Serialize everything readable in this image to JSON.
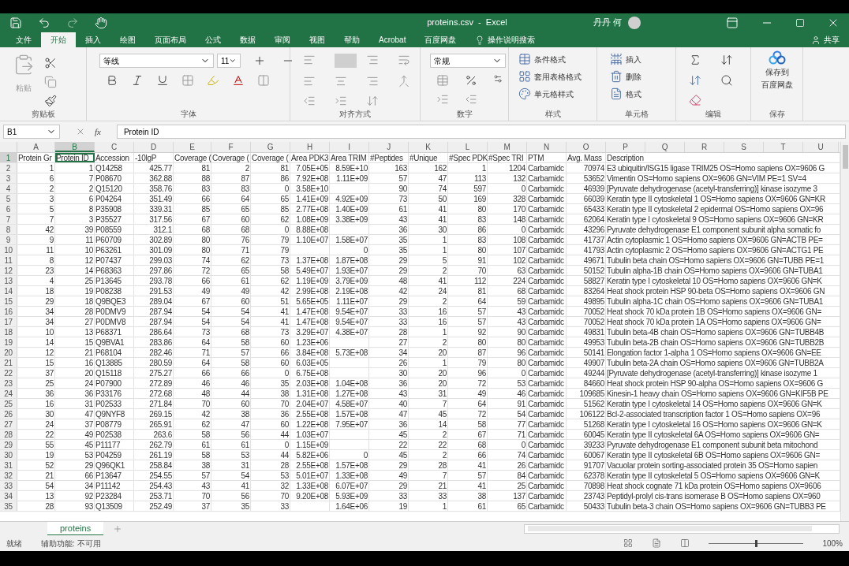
{
  "title_bar": {
    "title": "proteins.csv  -  Excel",
    "user": "丹丹 何"
  },
  "ribbon_tabs": [
    {
      "label": "文件",
      "selected": false
    },
    {
      "label": "开始",
      "selected": true
    },
    {
      "label": "插入",
      "selected": false
    },
    {
      "label": "绘图",
      "selected": false
    },
    {
      "label": "页面布局",
      "selected": false
    },
    {
      "label": "公式",
      "selected": false
    },
    {
      "label": "数据",
      "selected": false
    },
    {
      "label": "审阅",
      "selected": false
    },
    {
      "label": "视图",
      "selected": false
    },
    {
      "label": "帮助",
      "selected": false
    },
    {
      "label": "Acrobat",
      "selected": false
    },
    {
      "label": "百度网盘",
      "selected": false
    }
  ],
  "tell_me": "操作说明搜索",
  "share": "共享",
  "ribbon": {
    "clipboard": {
      "paste": "粘贴",
      "label": "剪贴板"
    },
    "font": {
      "font_name": "等线",
      "font_size": "11",
      "label": "字体"
    },
    "alignment": {
      "label": "对齐方式"
    },
    "number": {
      "format": "常规",
      "label": "数字"
    },
    "styles": {
      "items": [
        "条件格式",
        "套用表格格式",
        "单元格样式"
      ],
      "label": "样式"
    },
    "cells": {
      "items": [
        "插入",
        "删除",
        "格式"
      ],
      "label": "单元格"
    },
    "editing": {
      "label": "编辑"
    },
    "save": {
      "button": [
        "保存到",
        "百度网盘"
      ],
      "label": "保存"
    }
  },
  "formula_bar": {
    "name_box": "B1",
    "fx": "fx",
    "formula": "Protein ID"
  },
  "columns": [
    {
      "letter": "A",
      "selected": false
    },
    {
      "letter": "B",
      "selected": true
    },
    {
      "letter": "C",
      "selected": false
    },
    {
      "letter": "D",
      "selected": false
    },
    {
      "letter": "E",
      "selected": false
    },
    {
      "letter": "F",
      "selected": false
    },
    {
      "letter": "G",
      "selected": false
    },
    {
      "letter": "H",
      "selected": false
    },
    {
      "letter": "I",
      "selected": false
    },
    {
      "letter": "J",
      "selected": false
    },
    {
      "letter": "K",
      "selected": false
    },
    {
      "letter": "L",
      "selected": false
    },
    {
      "letter": "M",
      "selected": false
    },
    {
      "letter": "N",
      "selected": false
    },
    {
      "letter": "O",
      "selected": false
    },
    {
      "letter": "P",
      "selected": false
    },
    {
      "letter": "Q",
      "selected": false
    },
    {
      "letter": "R",
      "selected": false
    },
    {
      "letter": "S",
      "selected": false
    },
    {
      "letter": "T",
      "selected": false
    },
    {
      "letter": "U",
      "selected": false
    }
  ],
  "rows": [
    {
      "number": "1",
      "selected": true,
      "cells": [
        "Protein Gr",
        "Protein ID",
        "Accession",
        "-10lgP",
        "Coverage (",
        "Coverage (",
        "Coverage (",
        "Area PDK3",
        "Area TRIM",
        "#Peptides",
        "#Unique",
        "#Spec PDK",
        "#Spec TRI",
        "PTM",
        "Avg. Mass",
        "Description"
      ]
    },
    {
      "number": "2",
      "selected": false,
      "cells": [
        "1",
        "1",
        "Q14258",
        "425.77",
        "81",
        "2",
        "81",
        "7.05E+05",
        "8.59E+10",
        "163",
        "162",
        "1",
        "1204",
        "Carbamidc",
        "70974",
        "E3 ubiquitin/ISG15 ligase TRIM25 OS=Homo sapiens OX=9606 G"
      ]
    },
    {
      "number": "3",
      "selected": false,
      "cells": [
        "6",
        "7",
        "P08670",
        "362.88",
        "88",
        "87",
        "86",
        "7.92E+08",
        "1.11E+09",
        "57",
        "47",
        "113",
        "132",
        "Carbamidc",
        "53652",
        "Vimentin OS=Homo sapiens OX=9606 GN=VIM PE=1 SV=4"
      ]
    },
    {
      "number": "4",
      "selected": false,
      "cells": [
        "2",
        "2",
        "Q15120",
        "358.76",
        "83",
        "83",
        "0",
        "3.58E+10",
        "",
        "90",
        "74",
        "597",
        "0",
        "Carbamidc",
        "46939",
        "[Pyruvate dehydrogenase (acetyl-transferring)] kinase isozyme 3"
      ]
    },
    {
      "number": "5",
      "selected": false,
      "cells": [
        "3",
        "6",
        "P04264",
        "351.49",
        "66",
        "64",
        "65",
        "1.41E+09",
        "4.92E+09",
        "73",
        "50",
        "169",
        "328",
        "Carbamidc",
        "66039",
        "Keratin  type II cytoskeletal 1 OS=Homo sapiens OX=9606 GN=KR"
      ]
    },
    {
      "number": "6",
      "selected": false,
      "cells": [
        "5",
        "8",
        "P35908",
        "339.31",
        "85",
        "65",
        "85",
        "2.77E+08",
        "1.40E+09",
        "61",
        "41",
        "80",
        "170",
        "Carbamidc",
        "65433",
        "Keratin  type II cytoskeletal 2 epidermal OS=Homo sapiens OX=96"
      ]
    },
    {
      "number": "7",
      "selected": false,
      "cells": [
        "7",
        "3",
        "P35527",
        "317.56",
        "67",
        "60",
        "62",
        "1.08E+09",
        "3.38E+09",
        "43",
        "41",
        "83",
        "148",
        "Carbamidc",
        "62064",
        "Keratin  type I cytoskeletal 9 OS=Homo sapiens OX=9606 GN=KR"
      ]
    },
    {
      "number": "8",
      "selected": false,
      "cells": [
        "42",
        "39",
        "P08559",
        "312.1",
        "68",
        "68",
        "0",
        "8.88E+08",
        "",
        "36",
        "30",
        "86",
        "0",
        "Carbamidc",
        "43296",
        "Pyruvate dehydrogenase E1 component subunit alpha  somatic fo"
      ]
    },
    {
      "number": "9",
      "selected": false,
      "cells": [
        "9",
        "11",
        "P60709",
        "302.89",
        "80",
        "76",
        "79",
        "1.10E+07",
        "1.58E+07",
        "35",
        "1",
        "83",
        "108",
        "Carbamidc",
        "41737",
        "Actin  cytoplasmic 1 OS=Homo sapiens OX=9606 GN=ACTB PE="
      ]
    },
    {
      "number": "10",
      "selected": false,
      "cells": [
        "11",
        "10",
        "P63261",
        "301.09",
        "80",
        "71",
        "79",
        "",
        "0",
        "35",
        "1",
        "80",
        "107",
        "Carbamidc",
        "41793",
        "Actin  cytoplasmic 2 OS=Homo sapiens OX=9606 GN=ACTG1 PE"
      ]
    },
    {
      "number": "11",
      "selected": false,
      "cells": [
        "8",
        "12",
        "P07437",
        "299.03",
        "74",
        "62",
        "73",
        "1.37E+08",
        "1.87E+08",
        "29",
        "5",
        "91",
        "102",
        "Carbamidc",
        "49671",
        "Tubulin beta chain OS=Homo sapiens OX=9606 GN=TUBB PE=1"
      ]
    },
    {
      "number": "12",
      "selected": false,
      "cells": [
        "23",
        "14",
        "P68363",
        "297.86",
        "72",
        "65",
        "58",
        "5.49E+07",
        "1.93E+07",
        "29",
        "2",
        "70",
        "63",
        "Carbamidc",
        "50152",
        "Tubulin alpha-1B chain OS=Homo sapiens OX=9606 GN=TUBA1"
      ]
    },
    {
      "number": "13",
      "selected": false,
      "cells": [
        "4",
        "25",
        "P13645",
        "293.78",
        "66",
        "61",
        "62",
        "1.19E+09",
        "3.79E+09",
        "48",
        "41",
        "112",
        "224",
        "Carbamidc",
        "58827",
        "Keratin  type I cytoskeletal 10 OS=Homo sapiens OX=9606 GN=K"
      ]
    },
    {
      "number": "14",
      "selected": false,
      "cells": [
        "18",
        "19",
        "P08238",
        "291.53",
        "49",
        "49",
        "42",
        "2.99E+08",
        "2.19E+08",
        "42",
        "24",
        "81",
        "68",
        "Carbamidc",
        "83264",
        "Heat shock protein HSP 90-beta OS=Homo sapiens OX=9606 GN"
      ]
    },
    {
      "number": "15",
      "selected": false,
      "cells": [
        "29",
        "18",
        "Q9BQE3",
        "289.04",
        "67",
        "60",
        "51",
        "5.65E+05",
        "1.11E+07",
        "29",
        "2",
        "64",
        "59",
        "Carbamidc",
        "49895",
        "Tubulin alpha-1C chain OS=Homo sapiens OX=9606 GN=TUBA1"
      ]
    },
    {
      "number": "16",
      "selected": false,
      "cells": [
        "34",
        "28",
        "P0DMV9",
        "287.94",
        "54",
        "54",
        "41",
        "1.47E+08",
        "9.54E+07",
        "33",
        "16",
        "57",
        "43",
        "Carbamidc",
        "70052",
        "Heat shock 70 kDa protein 1B OS=Homo sapiens OX=9606 GN="
      ]
    },
    {
      "number": "17",
      "selected": false,
      "cells": [
        "34",
        "27",
        "P0DMV8",
        "287.94",
        "54",
        "54",
        "41",
        "1.47E+08",
        "9.54E+07",
        "33",
        "16",
        "57",
        "43",
        "Carbamidc",
        "70052",
        "Heat shock 70 kDa protein 1A OS=Homo sapiens OX=9606 GN="
      ]
    },
    {
      "number": "18",
      "selected": false,
      "cells": [
        "10",
        "13",
        "P68371",
        "286.64",
        "73",
        "68",
        "73",
        "3.29E+07",
        "4.38E+07",
        "28",
        "1",
        "92",
        "90",
        "Carbamidc",
        "49831",
        "Tubulin beta-4B chain OS=Homo sapiens OX=9606 GN=TUBB4B"
      ]
    },
    {
      "number": "19",
      "selected": false,
      "cells": [
        "14",
        "15",
        "Q9BVA1",
        "283.86",
        "64",
        "58",
        "60",
        "1.23E+06",
        "",
        "27",
        "2",
        "80",
        "80",
        "Carbamidc",
        "49953",
        "Tubulin beta-2B chain OS=Homo sapiens OX=9606 GN=TUBB2B"
      ]
    },
    {
      "number": "20",
      "selected": false,
      "cells": [
        "12",
        "21",
        "P68104",
        "282.46",
        "71",
        "57",
        "66",
        "3.84E+08",
        "5.73E+08",
        "34",
        "20",
        "87",
        "96",
        "Carbamidc",
        "50141",
        "Elongation factor 1-alpha 1 OS=Homo sapiens OX=9606 GN=EE"
      ]
    },
    {
      "number": "21",
      "selected": false,
      "cells": [
        "15",
        "16",
        "Q13885",
        "280.59",
        "64",
        "58",
        "60",
        "6.03E+05",
        "",
        "26",
        "1",
        "79",
        "80",
        "Carbamidc",
        "49907",
        "Tubulin beta-2A chain OS=Homo sapiens OX=9606 GN=TUBB2A"
      ]
    },
    {
      "number": "22",
      "selected": false,
      "cells": [
        "37",
        "20",
        "Q15118",
        "275.27",
        "66",
        "66",
        "0",
        "6.75E+08",
        "",
        "30",
        "20",
        "96",
        "0",
        "Carbamidc",
        "49244",
        "[Pyruvate dehydrogenase (acetyl-transferring)] kinase isozyme 1"
      ]
    },
    {
      "number": "23",
      "selected": false,
      "cells": [
        "25",
        "24",
        "P07900",
        "272.89",
        "46",
        "46",
        "35",
        "2.03E+08",
        "1.04E+08",
        "36",
        "20",
        "72",
        "53",
        "Carbamidc",
        "84660",
        "Heat shock protein HSP 90-alpha OS=Homo sapiens OX=9606 G"
      ]
    },
    {
      "number": "24",
      "selected": false,
      "cells": [
        "36",
        "36",
        "P33176",
        "272.68",
        "48",
        "44",
        "38",
        "1.31E+08",
        "1.27E+08",
        "43",
        "31",
        "49",
        "46",
        "Carbamidc",
        "109685",
        "Kinesin-1 heavy chain OS=Homo sapiens OX=9606 GN=KIF5B PE"
      ]
    },
    {
      "number": "25",
      "selected": false,
      "cells": [
        "16",
        "31",
        "P02533",
        "271.84",
        "70",
        "60",
        "70",
        "2.04E+07",
        "4.58E+07",
        "40",
        "7",
        "64",
        "91",
        "Carbamidc",
        "51562",
        "Keratin  type I cytoskeletal 14 OS=Homo sapiens OX=9606 GN=K"
      ]
    },
    {
      "number": "26",
      "selected": false,
      "cells": [
        "30",
        "47",
        "Q9NYF8",
        "269.15",
        "42",
        "38",
        "36",
        "2.55E+08",
        "1.57E+08",
        "47",
        "45",
        "72",
        "54",
        "Carbamidc",
        "106122",
        "Bcl-2-associated transcription factor 1 OS=Homo sapiens OX=96"
      ]
    },
    {
      "number": "27",
      "selected": false,
      "cells": [
        "24",
        "37",
        "P08779",
        "265.91",
        "62",
        "47",
        "60",
        "1.22E+08",
        "7.95E+07",
        "36",
        "14",
        "58",
        "77",
        "Carbamidc",
        "51268",
        "Keratin  type I cytoskeletal 16 OS=Homo sapiens OX=9606 GN=K"
      ]
    },
    {
      "number": "28",
      "selected": false,
      "cells": [
        "22",
        "49",
        "P02538",
        "263.6",
        "58",
        "56",
        "44",
        "1.03E+07",
        "",
        "45",
        "2",
        "67",
        "71",
        "Carbamidc",
        "60045",
        "Keratin  type II cytoskeletal 6A OS=Homo sapiens OX=9606 GN="
      ]
    },
    {
      "number": "29",
      "selected": false,
      "cells": [
        "55",
        "45",
        "P11177",
        "262.79",
        "61",
        "61",
        "0",
        "1.15E+09",
        "",
        "22",
        "22",
        "68",
        "0",
        "Carbamidc",
        "39233",
        "Pyruvate dehydrogenase E1 component subunit beta  mitochond"
      ]
    },
    {
      "number": "30",
      "selected": false,
      "cells": [
        "19",
        "53",
        "P04259",
        "261.19",
        "58",
        "53",
        "44",
        "5.82E+06",
        "0",
        "45",
        "2",
        "66",
        "74",
        "Carbamidc",
        "60067",
        "Keratin  type II cytoskeletal 6B OS=Homo sapiens OX=9606 GN="
      ]
    },
    {
      "number": "31",
      "selected": false,
      "cells": [
        "52",
        "29",
        "Q96QK1",
        "258.84",
        "38",
        "31",
        "28",
        "2.55E+08",
        "1.57E+08",
        "29",
        "28",
        "41",
        "26",
        "Carbamidc",
        "91707",
        "Vacuolar protein sorting-associated protein 35 OS=Homo sapien"
      ]
    },
    {
      "number": "32",
      "selected": false,
      "cells": [
        "21",
        "66",
        "P13647",
        "254.55",
        "57",
        "54",
        "53",
        "5.01E+07",
        "1.33E+08",
        "49",
        "7",
        "57",
        "84",
        "Carbamidc",
        "62378",
        "Keratin  type II cytoskeletal 5 OS=Homo sapiens OX=9606 GN=K"
      ]
    },
    {
      "number": "33",
      "selected": false,
      "cells": [
        "54",
        "34",
        "P11142",
        "254.43",
        "43",
        "41",
        "32",
        "1.33E+08",
        "6.07E+07",
        "29",
        "21",
        "41",
        "25",
        "Carbamidc",
        "70898",
        "Heat shock cognate 71 kDa protein OS=Homo sapiens OX=9606"
      ]
    },
    {
      "number": "34",
      "selected": false,
      "cells": [
        "13",
        "92",
        "P23284",
        "253.71",
        "70",
        "56",
        "70",
        "9.20E+08",
        "5.93E+09",
        "33",
        "33",
        "38",
        "137",
        "Carbamidc",
        "23743",
        "Peptidyl-prolyl cis-trans isomerase B OS=Homo sapiens OX=960"
      ]
    },
    {
      "number": "35",
      "selected": false,
      "cells": [
        "28",
        "93",
        "Q13509",
        "252.49",
        "37",
        "35",
        "33",
        "",
        "1.64E+06",
        "19",
        "1",
        "61",
        "65",
        "Carbamidc",
        "50433",
        "Tubulin beta-3 chain OS=Homo sapiens OX=9606 GN=TUBB3 PE"
      ]
    }
  ],
  "sheet_tabs": [
    {
      "label": "proteins",
      "selected": true
    }
  ],
  "status_bar": {
    "ready": "就绪",
    "accessibility": "辅助功能: 不可用",
    "zoom_slider": {
      "level": 0.5
    },
    "zoom": "100%"
  }
}
